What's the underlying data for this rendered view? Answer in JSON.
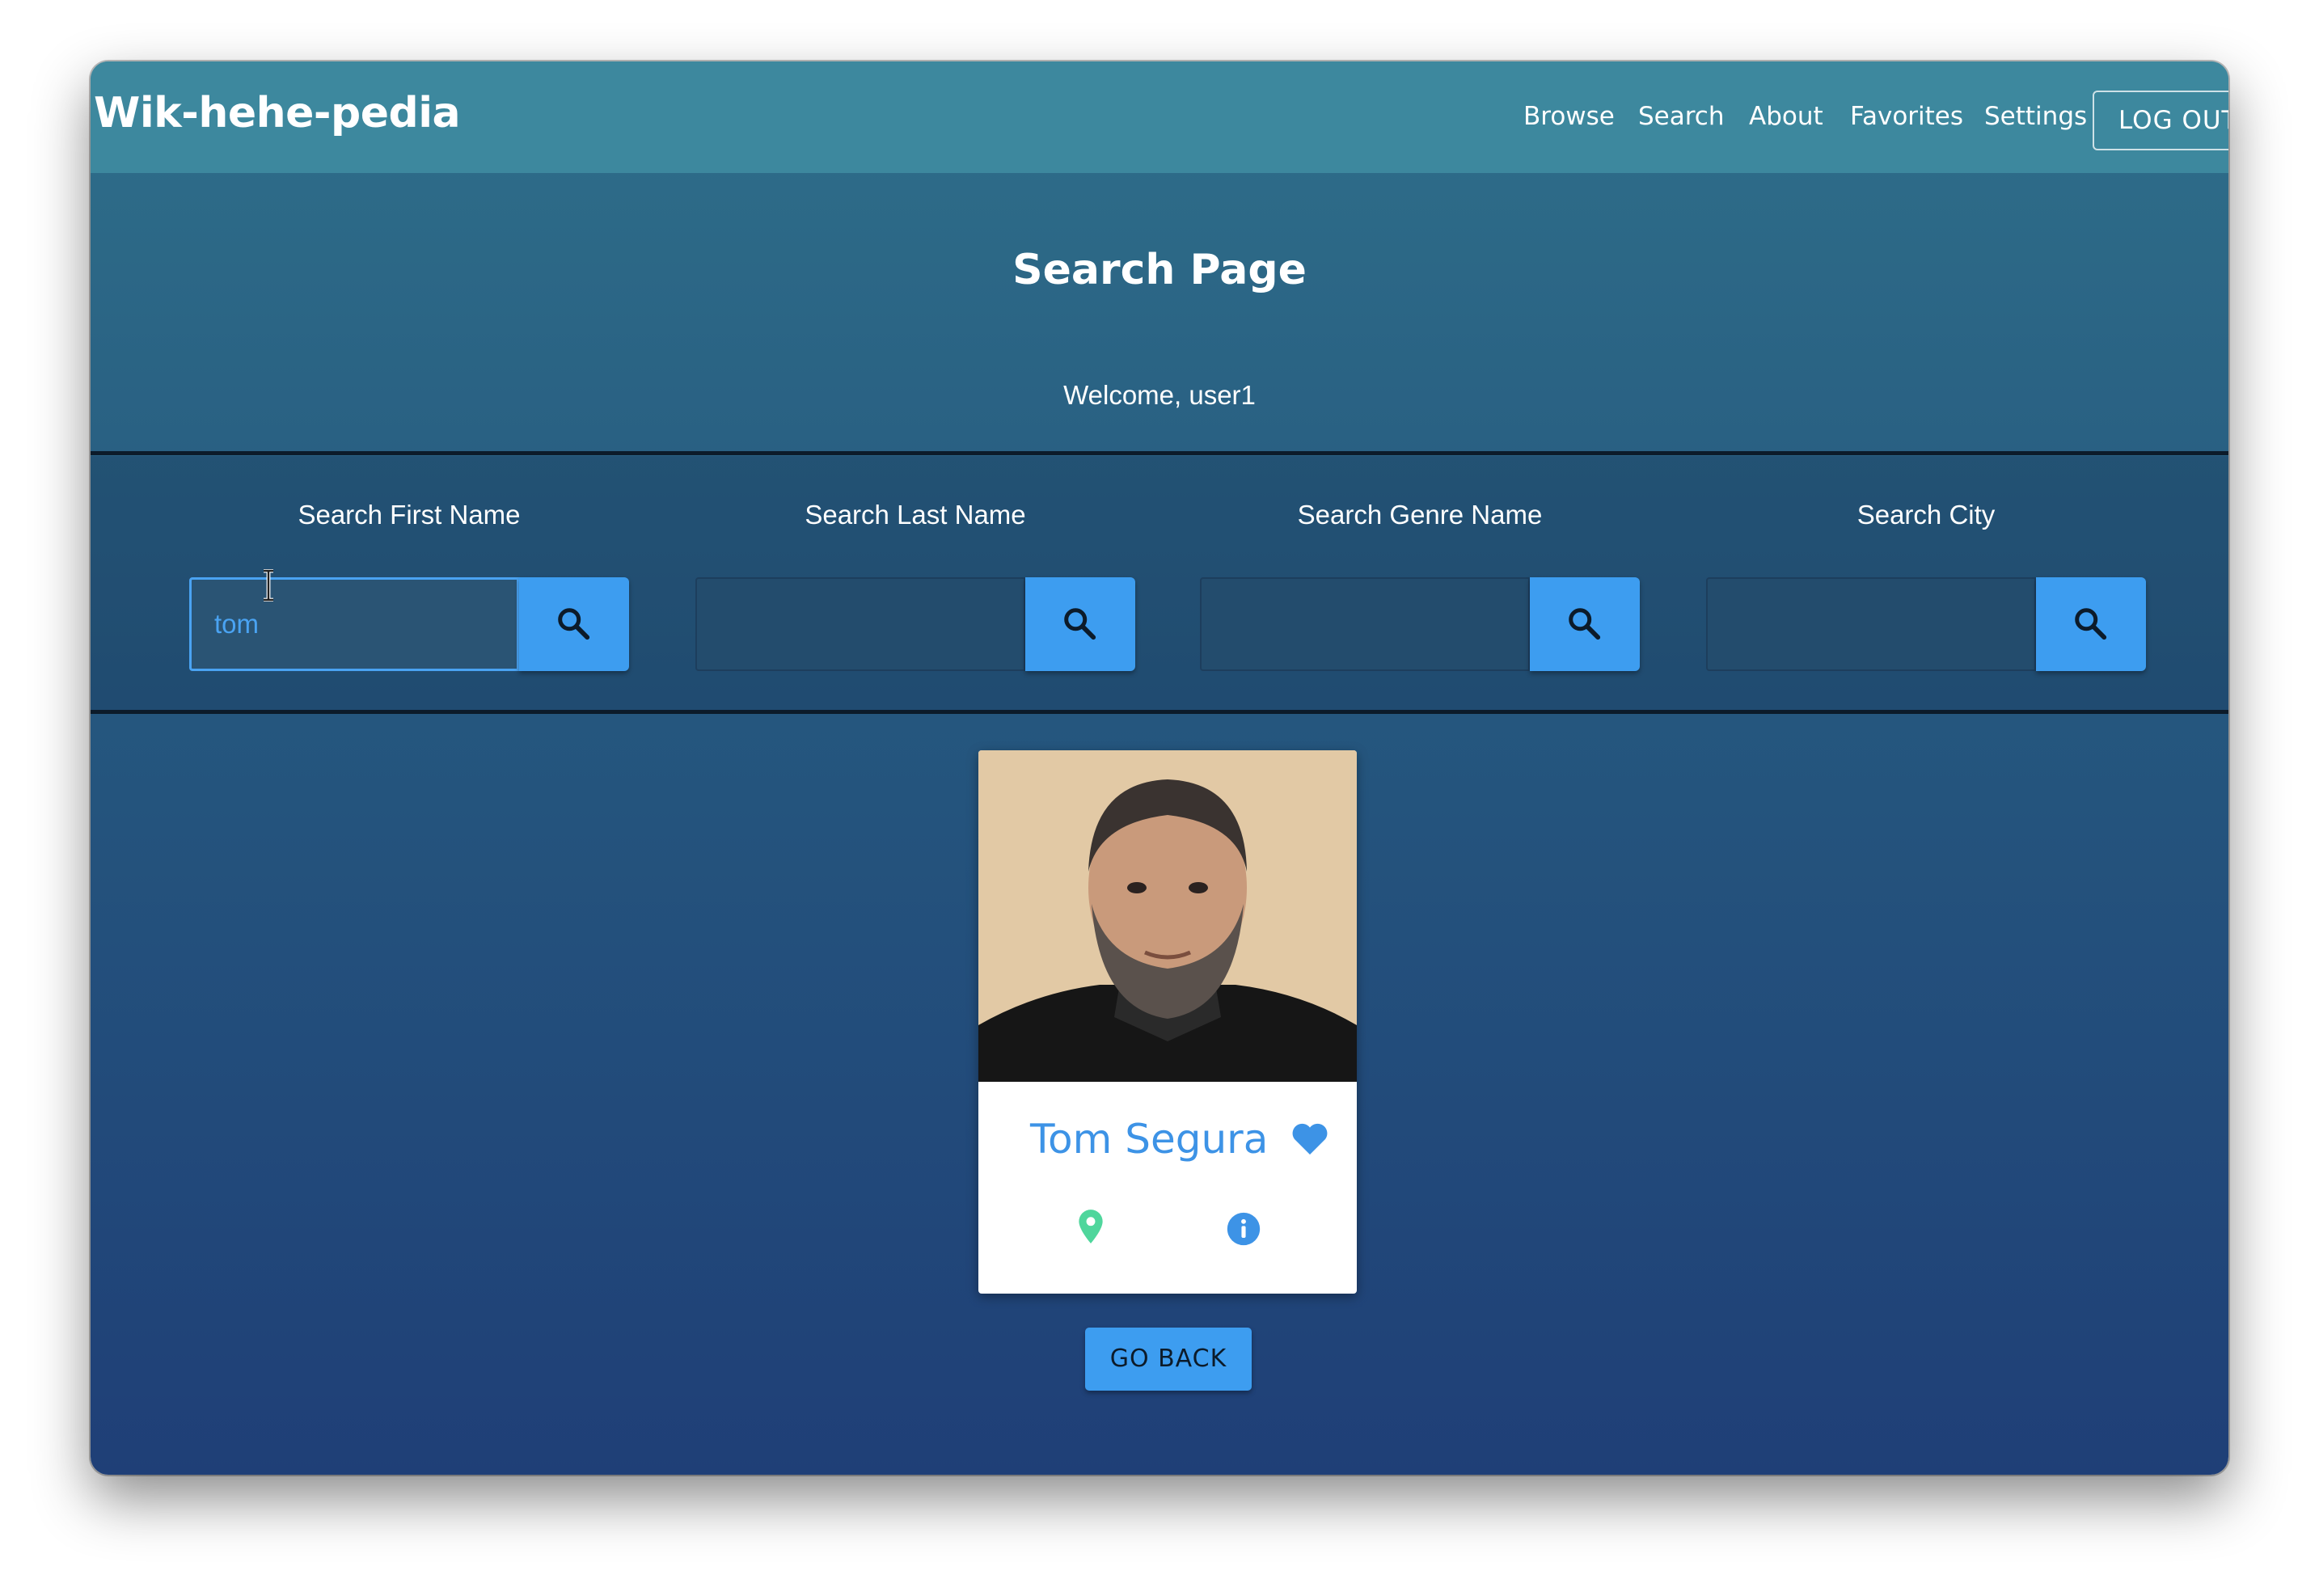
{
  "navbar": {
    "brand": "Wik-hehe-pedia",
    "links": [
      "Browse",
      "Search",
      "About",
      "Favorites",
      "Settings"
    ],
    "logout_label": "LOG OUT"
  },
  "header": {
    "title": "Search Page",
    "welcome": "Welcome, user1"
  },
  "search": {
    "fields": [
      {
        "label": "Search First Name",
        "value": "tom"
      },
      {
        "label": "Search Last Name",
        "value": ""
      },
      {
        "label": "Search Genre Name",
        "value": ""
      },
      {
        "label": "Search City",
        "value": ""
      }
    ]
  },
  "results": {
    "cards": [
      {
        "name": "Tom Segura",
        "favorited": true
      }
    ]
  },
  "go_back_label": "GO BACK",
  "colors": {
    "accent": "#3d9df0",
    "navbar": "#3d889e",
    "heart": "#3d93e6",
    "pin": "#4fd69c"
  }
}
